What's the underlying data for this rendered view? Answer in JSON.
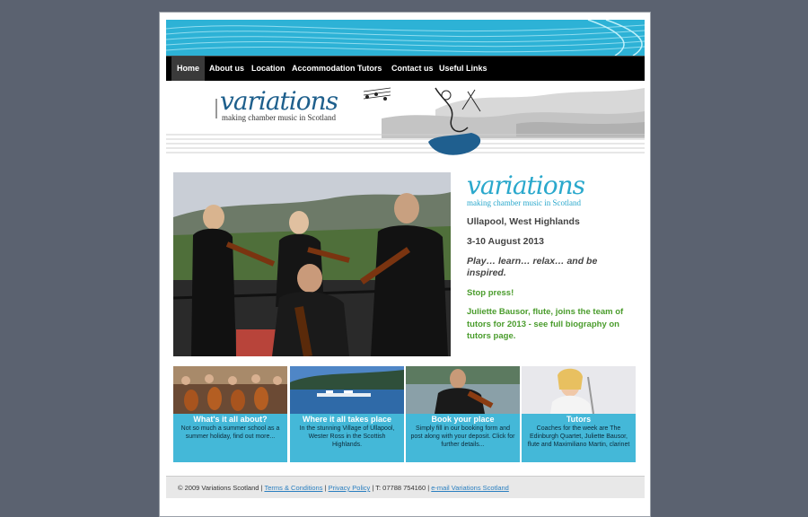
{
  "nav": {
    "items": [
      {
        "label": "Home"
      },
      {
        "label": "About us"
      },
      {
        "label": "Location"
      },
      {
        "label": "Accommodation"
      },
      {
        "label": "Tutors"
      },
      {
        "label": "Contact us"
      },
      {
        "label": "Useful Links"
      }
    ]
  },
  "header": {
    "logo_text": "variations",
    "logo_sub": "making chamber music in Scotland"
  },
  "info": {
    "logo_text": "variations",
    "logo_sub": "making chamber music in Scotland",
    "location": "Ullapool, West Highlands",
    "dates": "3-10 August 2013",
    "tagline": "Play… learn… relax… and be inspired.",
    "press": "Stop press!",
    "news": "Juliette Bausor, flute, joins the team of tutors for 2013 - see full biography on tutors page."
  },
  "tiles": [
    {
      "title": "What's it all about?",
      "desc": "Not so much a summer school as a summer holiday, find out more..."
    },
    {
      "title": "Where it all takes place",
      "desc": "In the stunning Village of Ullapool, Wester Ross in the Scottish Highlands."
    },
    {
      "title": "Book your place",
      "desc": "Simply fill in our booking form and post along with your deposit. Click for further details..."
    },
    {
      "title": "Tutors",
      "desc": "Coaches for the week are The Edinburgh Quartet, Juliette Bausor, flute and Maximiliano Martin, clarinet"
    }
  ],
  "footer": {
    "copyright": "© 2009 Variations Scotland",
    "sep1": " | ",
    "terms": "Terms & Conditions",
    "sep2": " | ",
    "privacy": "Privacy Policy",
    "phone": " | T: 07788 754160 | ",
    "email": "e-mail Variations Scotland"
  },
  "colors": {
    "banner": "#2db2d6",
    "nav": "#000000",
    "accent_green": "#4a9c2c",
    "tile": "#44b8d8"
  }
}
